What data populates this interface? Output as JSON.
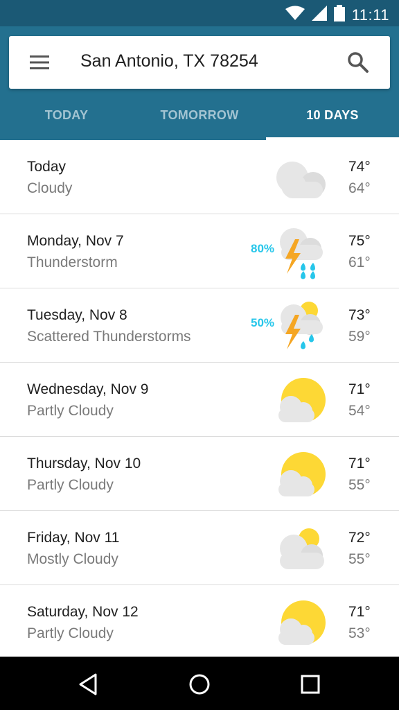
{
  "status_bar": {
    "time": "11:11",
    "icons": [
      "wifi-icon",
      "signal-icon",
      "battery-icon"
    ]
  },
  "search": {
    "location": "San Antonio, TX 78254",
    "menu_icon": "menu-icon",
    "search_icon": "search-icon"
  },
  "tabs": [
    {
      "label": "TODAY",
      "active": false
    },
    {
      "label": "TOMORROW",
      "active": false
    },
    {
      "label": "10 DAYS",
      "active": true
    }
  ],
  "forecast": [
    {
      "day": "Today",
      "condition": "Cloudy",
      "precip": "",
      "icon": "cloudy-icon",
      "high": "74°",
      "low": "64°"
    },
    {
      "day": "Monday, Nov 7",
      "condition": "Thunderstorm",
      "precip": "80%",
      "icon": "thunderstorm-icon",
      "high": "75°",
      "low": "61°"
    },
    {
      "day": "Tuesday, Nov 8",
      "condition": "Scattered Thunderstorms",
      "precip": "50%",
      "icon": "scattered-thunderstorms-icon",
      "high": "73°",
      "low": "59°"
    },
    {
      "day": "Wednesday, Nov 9",
      "condition": "Partly Cloudy",
      "precip": "",
      "icon": "partly-cloudy-icon",
      "high": "71°",
      "low": "54°"
    },
    {
      "day": "Thursday, Nov 10",
      "condition": "Partly Cloudy",
      "precip": "",
      "icon": "partly-cloudy-icon",
      "high": "71°",
      "low": "55°"
    },
    {
      "day": "Friday, Nov 11",
      "condition": "Mostly Cloudy",
      "precip": "",
      "icon": "mostly-cloudy-icon",
      "high": "72°",
      "low": "55°"
    },
    {
      "day": "Saturday, Nov 12",
      "condition": "Partly Cloudy",
      "precip": "",
      "icon": "partly-cloudy-icon",
      "high": "71°",
      "low": "53°"
    }
  ],
  "nav": [
    "back-icon",
    "home-icon",
    "recents-icon"
  ],
  "colors": {
    "app_bar": "#23708f",
    "status_bar": "#1b5975",
    "precip": "#26c6ea",
    "sun": "#fdd835",
    "cloud": "#e6e6e6",
    "bolt": "#f5a623",
    "rain": "#26c6ea"
  }
}
